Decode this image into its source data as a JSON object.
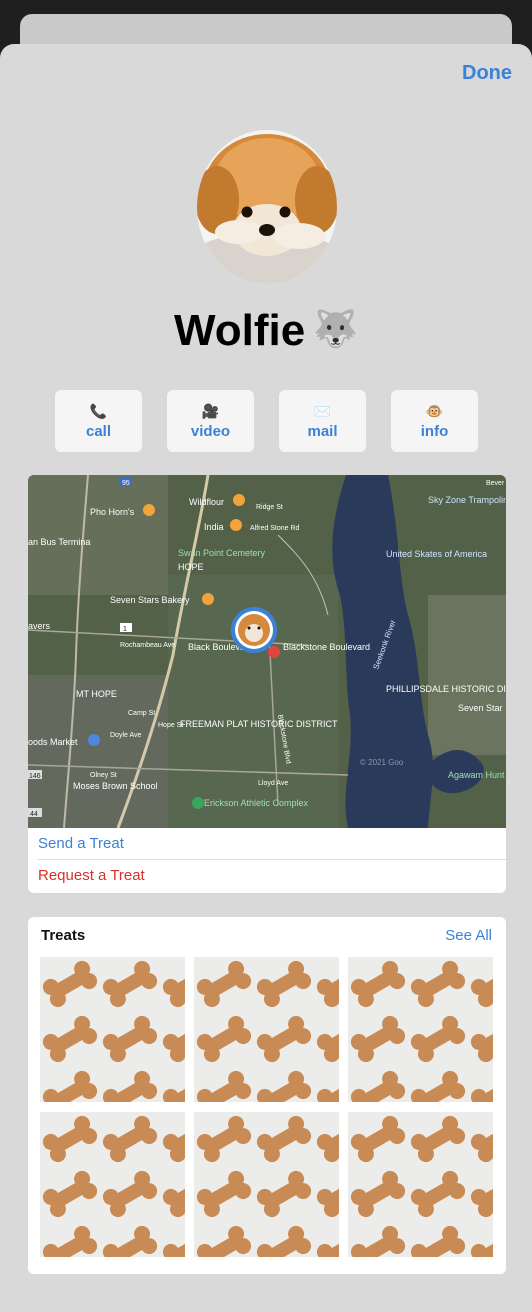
{
  "header": {
    "done_label": "Done"
  },
  "contact": {
    "name": "Wolfie",
    "name_emoji": "🐺"
  },
  "actions": [
    {
      "icon": "📞",
      "label": "call"
    },
    {
      "icon": "🎥",
      "label": "video"
    },
    {
      "icon": "✉️",
      "label": "mail"
    },
    {
      "icon": "🐵",
      "label": "info"
    }
  ],
  "map": {
    "labels": [
      "Pho Horn's",
      "Wildflour",
      "Ridge St",
      "India",
      "Alfred Stone Rd",
      "Sky Zone Trampoline Park",
      "an Bus Termina",
      "Swan Point Cemetery",
      "HOPE",
      "United Skates of America",
      "Seven Stars Bakery",
      "avers",
      "Rochambeau Ave",
      "Black Boulevard Re",
      "Blackstone Boulevard",
      "Seekonk River",
      "PHILLIPSDALE HISTORIC DISTRICT",
      "Seven Star",
      "MT HOPE",
      "Camp St",
      "Hope St",
      "Doyle Ave",
      "FREEMAN PLAT HISTORIC DISTRICT",
      "Blackstone Blvd",
      "oods Market",
      "Olney St",
      "Moses Brown School",
      "Lloyd Ave",
      "Agawam Hunt",
      "Erickson Athletic Complex",
      "© 2021 Goo",
      "95",
      "146",
      "44",
      "1",
      "Bever"
    ]
  },
  "links": {
    "send_treat": "Send a Treat",
    "request_treat": "Request a Treat"
  },
  "treats": {
    "title": "Treats",
    "see_all": "See All"
  },
  "colors": {
    "accent": "#3b82d6",
    "danger": "#d93025",
    "sheet": "#d9d9d9",
    "water": "#2a3a5a"
  }
}
